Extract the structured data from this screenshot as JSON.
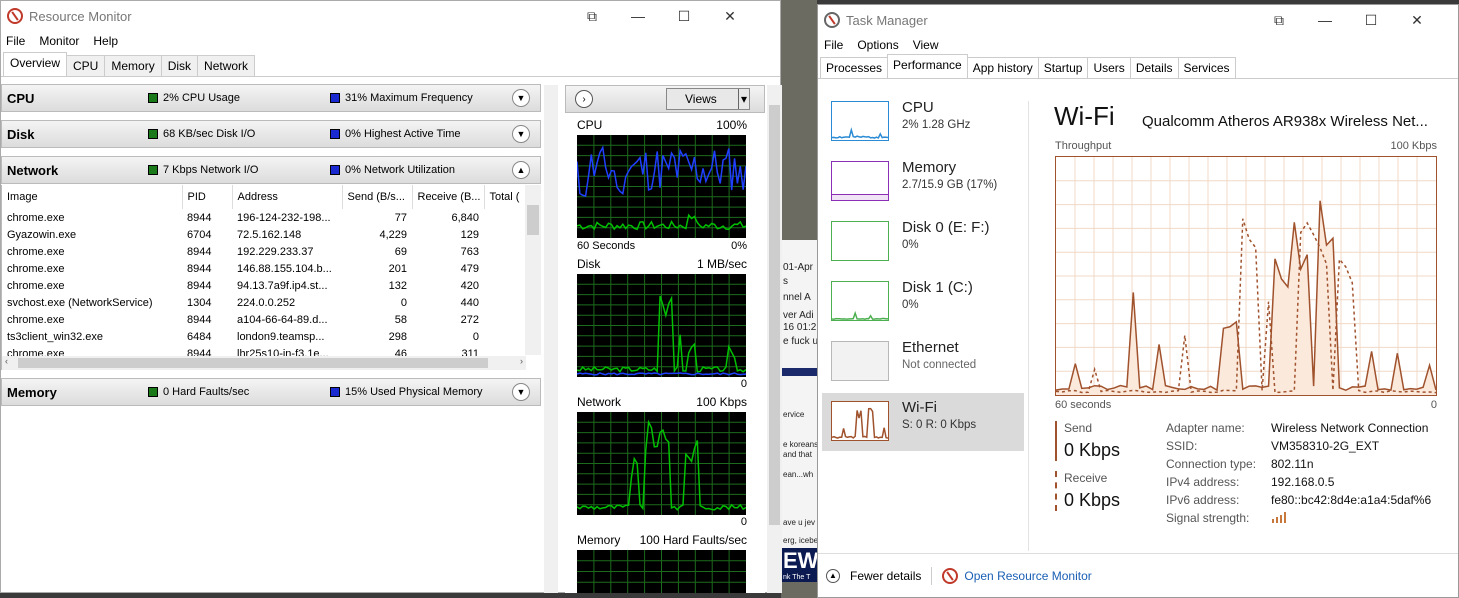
{
  "background": {
    "lines": [
      "01-Apr",
      "s",
      "nnel A",
      "ver Adi",
      "16 01:2",
      "e fuck u",
      "ervice",
      "e koreans",
      "and that",
      "ean...wh",
      "ave u jev",
      "erg, icebe",
      "nk The T"
    ],
    "news_text": "EW"
  },
  "resmon": {
    "title": "Resource Monitor",
    "menu": [
      "File",
      "Monitor",
      "Help"
    ],
    "tabs": [
      "Overview",
      "CPU",
      "Memory",
      "Disk",
      "Network"
    ],
    "sections": {
      "cpu": {
        "name": "CPU",
        "m1": "2% CPU Usage",
        "m2": "31% Maximum Frequency"
      },
      "disk": {
        "name": "Disk",
        "m1": "68 KB/sec Disk I/O",
        "m2": "0% Highest Active Time"
      },
      "network": {
        "name": "Network",
        "m1": "7 Kbps Network I/O",
        "m2": "0% Network Utilization"
      },
      "memory": {
        "name": "Memory",
        "m1": "0 Hard Faults/sec",
        "m2": "15% Used Physical Memory"
      }
    },
    "net_columns": [
      "Image",
      "PID",
      "Address",
      "Send (B/s...",
      "Receive (B...",
      "Total ("
    ],
    "net_rows": [
      [
        "chrome.exe",
        "8944",
        "196-124-232-198...",
        "77",
        "6,840"
      ],
      [
        "Gyazowin.exe",
        "6704",
        "72.5.162.148",
        "4,229",
        "129"
      ],
      [
        "chrome.exe",
        "8944",
        "192.229.233.37",
        "69",
        "763"
      ],
      [
        "chrome.exe",
        "8944",
        "146.88.155.104.b...",
        "201",
        "479"
      ],
      [
        "chrome.exe",
        "8944",
        "94.13.7a9f.ip4.st...",
        "132",
        "420"
      ],
      [
        "svchost.exe (NetworkService)",
        "1304",
        "224.0.0.252",
        "0",
        "440"
      ],
      [
        "chrome.exe",
        "8944",
        "a104-66-64-89.d...",
        "58",
        "272"
      ],
      [
        "ts3client_win32.exe",
        "6484",
        "london9.teamsp...",
        "298",
        "0"
      ],
      [
        "chrome.exe",
        "8944",
        "lhr25s10-in-f3.1e...",
        "46",
        "311"
      ]
    ],
    "views_label": "Views",
    "graphs": {
      "cpu": {
        "label": "CPU",
        "max": "100%",
        "foot_left": "60 Seconds",
        "foot_right": "0%"
      },
      "disk": {
        "label": "Disk",
        "max": "1 MB/sec",
        "foot_left": "",
        "foot_right": "0"
      },
      "network": {
        "label": "Network",
        "max": "100 Kbps",
        "foot_left": "",
        "foot_right": "0"
      },
      "memory": {
        "label": "Memory",
        "max": "100 Hard Faults/sec"
      }
    }
  },
  "taskmgr": {
    "title": "Task Manager",
    "menu": [
      "File",
      "Options",
      "View"
    ],
    "tabs": [
      "Processes",
      "Performance",
      "App history",
      "Startup",
      "Users",
      "Details",
      "Services"
    ],
    "sidebar": [
      {
        "name": "CPU",
        "status": "2%  1.28 GHz",
        "color": "#2a8bd4"
      },
      {
        "name": "Memory",
        "status": "2.7/15.9 GB (17%)",
        "color": "#8b2fb5"
      },
      {
        "name": "Disk 0 (E: F:)",
        "status": "0%",
        "color": "#4caf50"
      },
      {
        "name": "Disk 1 (C:)",
        "status": "0%",
        "color": "#4caf50"
      },
      {
        "name": "Ethernet",
        "status": "Not connected",
        "color": "#a0a0a0"
      },
      {
        "name": "Wi-Fi",
        "status": "S: 0  R: 0 Kbps",
        "color": "#a0522d"
      }
    ],
    "main": {
      "title": "Wi-Fi",
      "adapter": "Qualcomm Atheros AR938x Wireless Net...",
      "throughput_label": "Throughput",
      "throughput_max": "100 Kbps",
      "foot_left": "60 seconds",
      "foot_right": "0",
      "send_label": "Send",
      "send_value": "0 Kbps",
      "receive_label": "Receive",
      "receive_value": "0 Kbps",
      "properties": [
        {
          "k": "Adapter name:",
          "v": "Wireless Network Connection"
        },
        {
          "k": "SSID:",
          "v": "VM358310-2G_EXT"
        },
        {
          "k": "Connection type:",
          "v": "802.11n"
        },
        {
          "k": "IPv4 address:",
          "v": "192.168.0.5"
        },
        {
          "k": "IPv6 address:",
          "v": "fe80::bc42:8d4e:a1a4:5daf%6"
        },
        {
          "k": "Signal strength:",
          "v": ""
        }
      ]
    },
    "footer": {
      "fewer": "Fewer details",
      "open_resmon": "Open Resource Monitor"
    }
  },
  "colors": {
    "wifi": "#a0522d",
    "rm_green": "#00c000",
    "rm_blue": "#2040ff",
    "link": "#1a5fb4"
  },
  "icons": [
    "resmon-app-icon",
    "taskmgr-app-icon",
    "minimize-icon",
    "maximize-icon",
    "close-icon",
    "snap-icon",
    "chevron-down-icon",
    "chevron-up-icon",
    "chevron-right-icon",
    "signal-icon"
  ]
}
